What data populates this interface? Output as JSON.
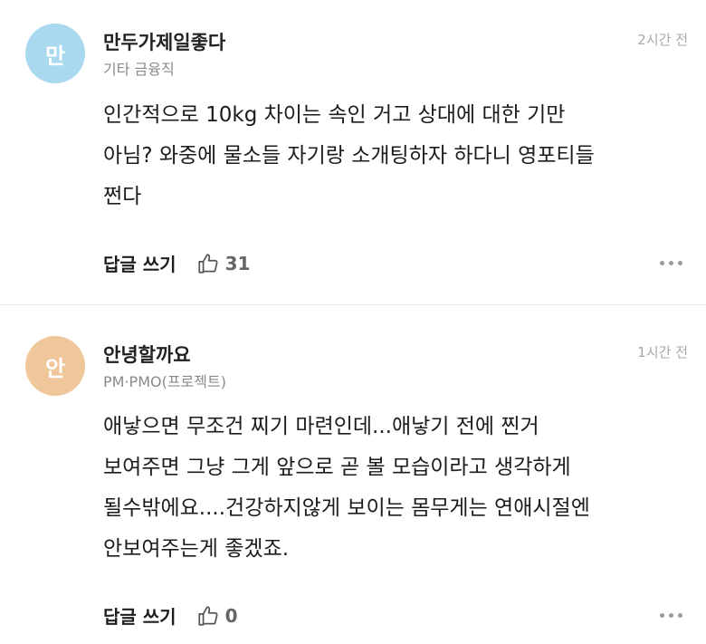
{
  "comments": [
    {
      "avatar_char": "만",
      "avatar_color": "#a9d9ef",
      "name": "만두가제일좋다",
      "job": "기타 금융직",
      "time": "2시간 전",
      "lines": [
        "인간적으로 10kg 차이는 속인 거고 상대에 대한 기만",
        "아님? 와중에 물소들 자기랑 소개팅하자 하다니 영포티들",
        "쩐다"
      ],
      "reply_label": "답글 쓰기",
      "likes": "31"
    },
    {
      "avatar_char": "안",
      "avatar_color": "#f0c79b",
      "name": "안녕할까요",
      "job": "PM·PMO(프로젝트)",
      "time": "1시간 전",
      "lines": [
        "애낳으면 무조건 찌기 마련인데...애낳기 전에 찐거",
        "보여주면 그냥 그게 앞으로 곧 볼 모습이라고 생각하게",
        "될수밖에요....건강하지않게 보이는 몸무게는 연애시절엔",
        "안보여주는게 좋겠죠."
      ],
      "reply_label": "답글 쓰기",
      "likes": "0"
    }
  ],
  "icons": {
    "like": "thumbs-up-outline-icon",
    "more": "more-horizontal-icon"
  }
}
